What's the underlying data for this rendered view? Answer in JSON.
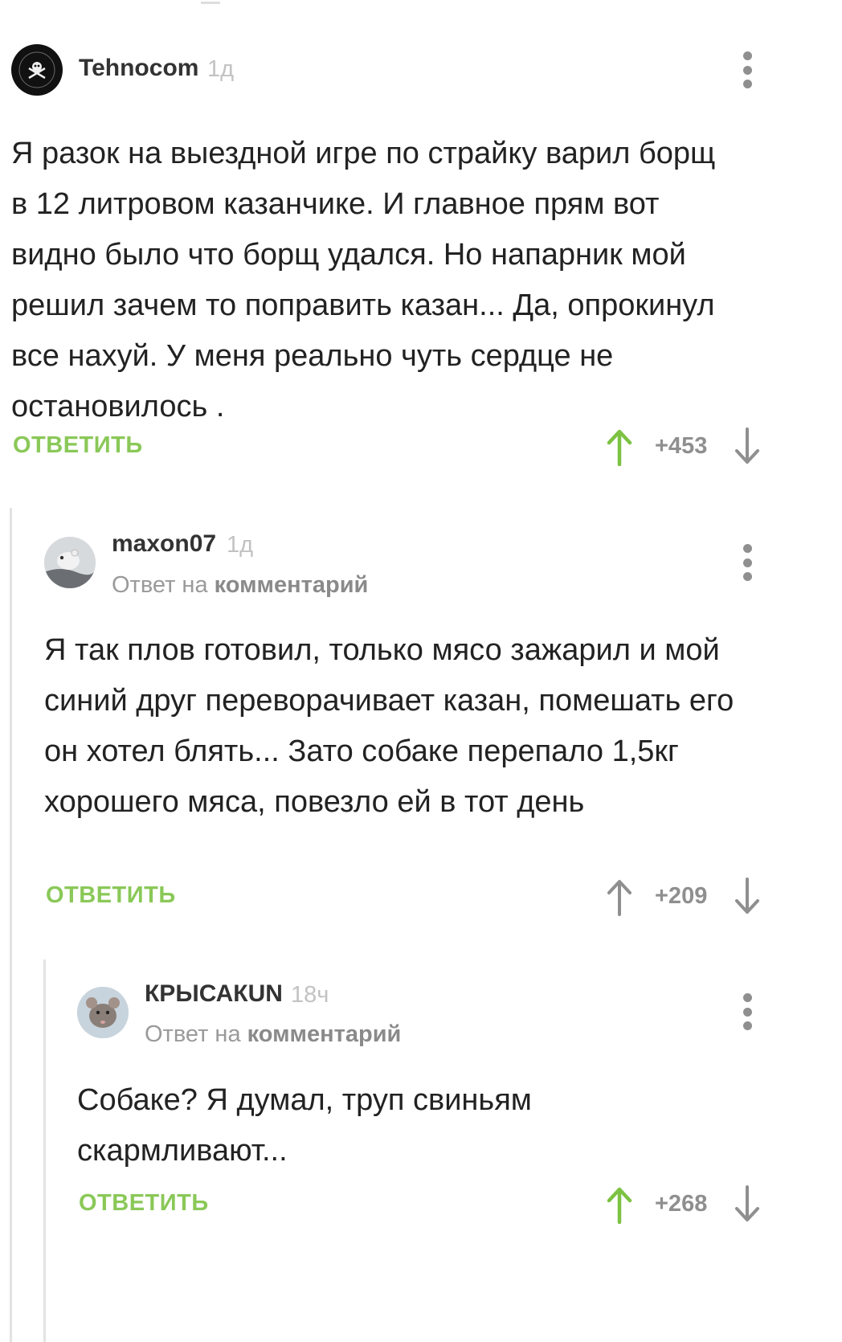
{
  "comments": [
    {
      "username": "Tehnocom",
      "time": "1д",
      "reply_prefix": "",
      "reply_link": "",
      "text": "Я разок на выездной игре по страйку варил борщ в 12 литровом казанчике. И главное прям вот видно было что борщ удался. Но напарник мой решил зачем то поправить казан... Да, опрокинул все нахуй. У меня реально чуть сердце не остановилось .",
      "reply_label": "ОТВЕТИТЬ",
      "rating": "+453",
      "upvoted": true
    },
    {
      "username": "maxon07",
      "time": "1д",
      "reply_prefix": "Ответ на",
      "reply_link": "комментарий",
      "text": "Я так плов готовил, только мясо зажарил и мой синий друг переворачивает казан, помешать его он хотел блять... Зато собаке перепало 1,5кг хорошего мяса, повезло ей в тот день",
      "reply_label": "ОТВЕТИТЬ",
      "rating": "+209",
      "upvoted": false
    },
    {
      "username": "КРЫСАКUN",
      "time": "18ч",
      "reply_prefix": "Ответ на",
      "reply_link": "комментарий",
      "text": "Собаке? Я думал, труп свиньям скармливают...",
      "reply_label": "ОТВЕТИТЬ",
      "rating": "+268",
      "upvoted": true
    }
  ],
  "colors": {
    "accent_green": "#8ac858",
    "upvote_active": "#7cc243",
    "vote_inactive": "#8f8f8f"
  },
  "icons": [
    "menu-dots-icon",
    "upvote-arrow-icon",
    "downvote-arrow-icon"
  ]
}
